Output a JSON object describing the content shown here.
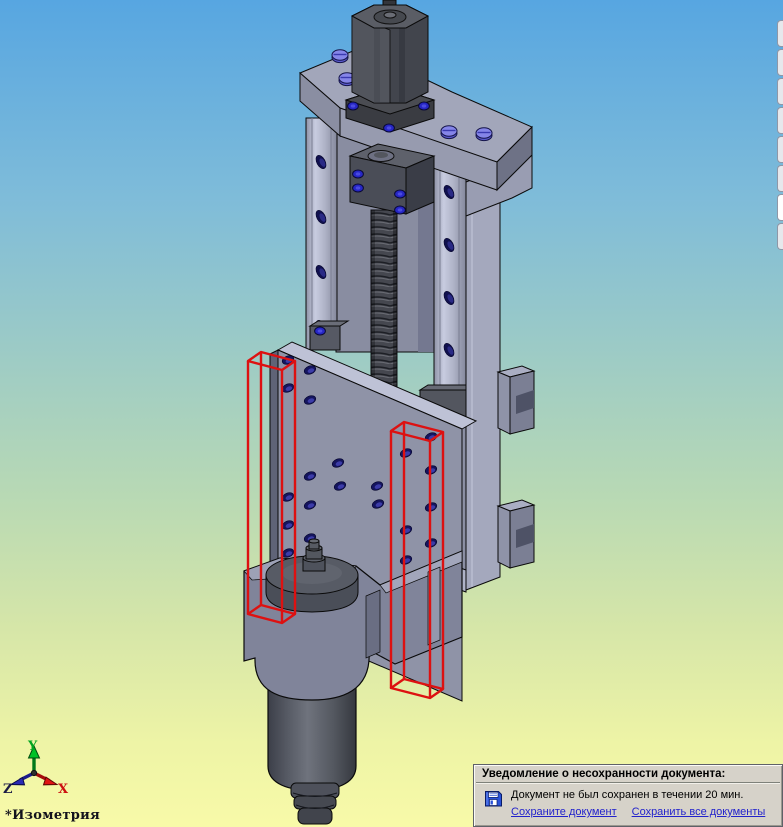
{
  "app": {
    "type": "cad-3d-viewport"
  },
  "viewport": {
    "view_label": "*Изометрия"
  },
  "triad": {
    "x_label": "X",
    "y_label": "Y",
    "z_label": "Z"
  },
  "model": {
    "parts": [
      "stepper-motor",
      "motor-mount-plate",
      "linear-rail-left",
      "linear-rail-right",
      "ball-screw",
      "bearing-block",
      "z-axis-column",
      "tool-mount-plate",
      "spindle-clamp",
      "spindle-motor",
      "collet-chuck"
    ],
    "selected_parts_highlighted": 2
  },
  "notification": {
    "title": "Уведомление о несохранности документа:",
    "message": "Документ не был сохранен в течении 20 мин.",
    "save_link": "Сохраните документ",
    "save_all_link": "Сохранить все документы"
  },
  "side_toolbar": {
    "button_count": 8,
    "active_index": 6
  },
  "colors": {
    "selection_highlight": "#DD1111",
    "link": "#2222CC",
    "sky_top": "#57A6E1",
    "sky_bottom": "#F8FAA8",
    "popup_background": "#D6D2C9",
    "axis_x": "#CC1010",
    "axis_y": "#00A51F",
    "axis_z": "#2A2AB0"
  }
}
